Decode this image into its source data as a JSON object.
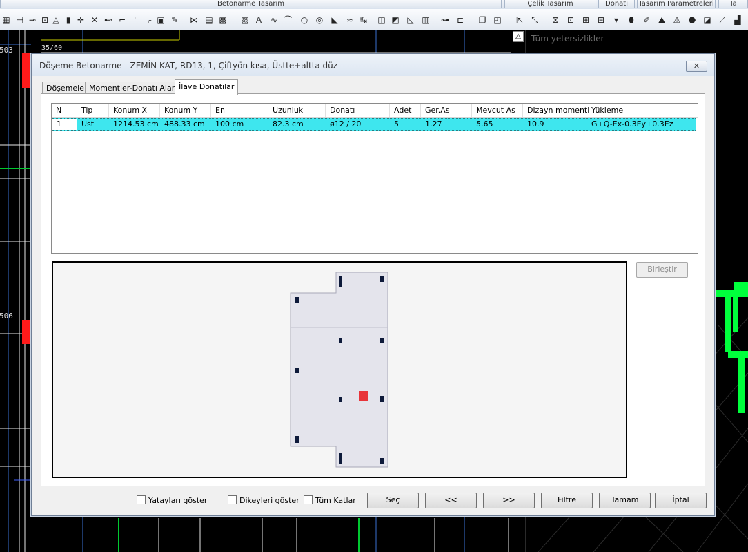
{
  "app": {
    "ribbon_tabs": [
      "Betonarme Tasarım",
      "Çelik Tasarım",
      "Donatı",
      "Tasarım Parametreleri",
      "Ta"
    ],
    "right_panel_title": "Tüm yetersizlikler",
    "cad_labels": {
      "beam_label": "35/60",
      "left_tag_1": "503",
      "left_tag_2": "506"
    }
  },
  "colors": {
    "selection_row": "#3ee6ee",
    "highlight_mark": "#e8343a",
    "slab_fill": "#e4e4ec",
    "rebar_mark": "#0e1a3a",
    "cad_green": "#00ff3c"
  },
  "dialog": {
    "title": "Döşeme Betonarme - ZEMİN KAT, RD13, 1, Çiftyön kısa, Üstte+altta düz",
    "close_label": "✕",
    "tabs": [
      {
        "label": "Döşemeler"
      },
      {
        "label": "Momentler-Donatı Alanları"
      },
      {
        "label": "İlave Donatılar"
      }
    ],
    "table": {
      "columns": [
        "N",
        "Tip",
        "Konum X",
        "Konum Y",
        "En",
        "Uzunluk",
        "Donatı",
        "Adet",
        "Ger.As",
        "Mevcut As",
        "Dizayn momenti",
        "Yükleme"
      ],
      "rows": [
        {
          "n": "1",
          "tip": "Üst",
          "konum_x": "1214.53 cm",
          "konum_y": "488.33 cm",
          "en": "100 cm",
          "uzunluk": "82.3 cm",
          "donati": "ø12 / 20",
          "adet": "5",
          "ger_as": "1.27",
          "mevcut_as": "5.65",
          "dizayn_momenti": "10.9",
          "yukleme": "G+Q-Ex-0.3Ey+0.3Ez"
        }
      ]
    },
    "merge_button": "Birleştir",
    "checkboxes": {
      "horizontal": {
        "label": "Yatayları göster",
        "checked": false
      },
      "vertical": {
        "label": "Dikeyleri göster",
        "checked": false
      },
      "all_floors": {
        "label": "Tüm Katlar",
        "checked": false
      }
    },
    "buttons": {
      "select": "Seç",
      "prev": "<<",
      "next": ">>",
      "filter": "Filtre",
      "ok": "Tamam",
      "cancel": "İptal"
    }
  }
}
